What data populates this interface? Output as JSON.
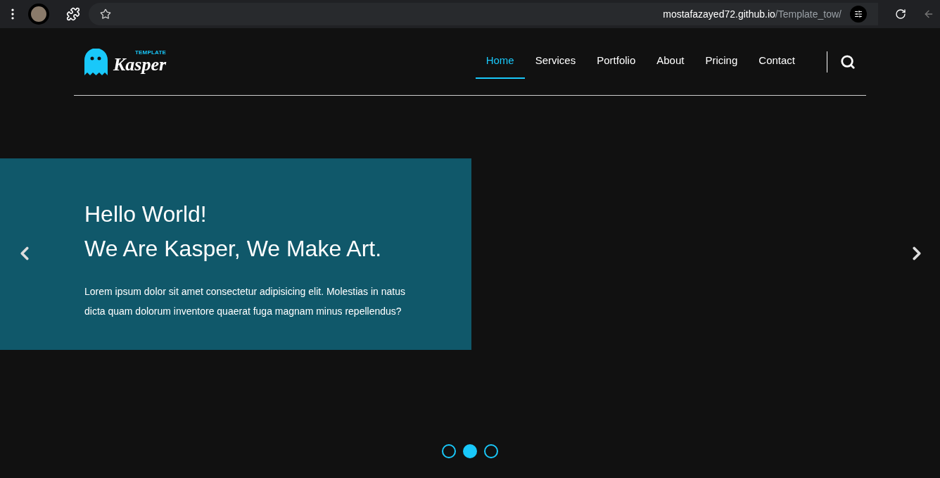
{
  "browser": {
    "url_host": "mostafazayed72.github.io",
    "url_path": "/Template_tow/"
  },
  "logo": {
    "tag": "TEMPLATE",
    "name": "Kasper"
  },
  "nav": [
    {
      "label": "Home",
      "selected": true
    },
    {
      "label": "Services",
      "selected": false
    },
    {
      "label": "Portfolio",
      "selected": false
    },
    {
      "label": "About",
      "selected": false
    },
    {
      "label": "Pricing",
      "selected": false
    },
    {
      "label": "Contact",
      "selected": false
    }
  ],
  "hero": {
    "title_lines": [
      "Hello World!",
      "We Are Kasper, We Make Art."
    ],
    "text": "Lorem ipsum dolor sit amet consectetur adipisicing elit. Molestias in natus dicta quam dolorum inventore quaerat fuga magnam minus repellendus?"
  },
  "slides": [
    {
      "selected": false
    },
    {
      "selected": true
    },
    {
      "selected": false
    }
  ]
}
